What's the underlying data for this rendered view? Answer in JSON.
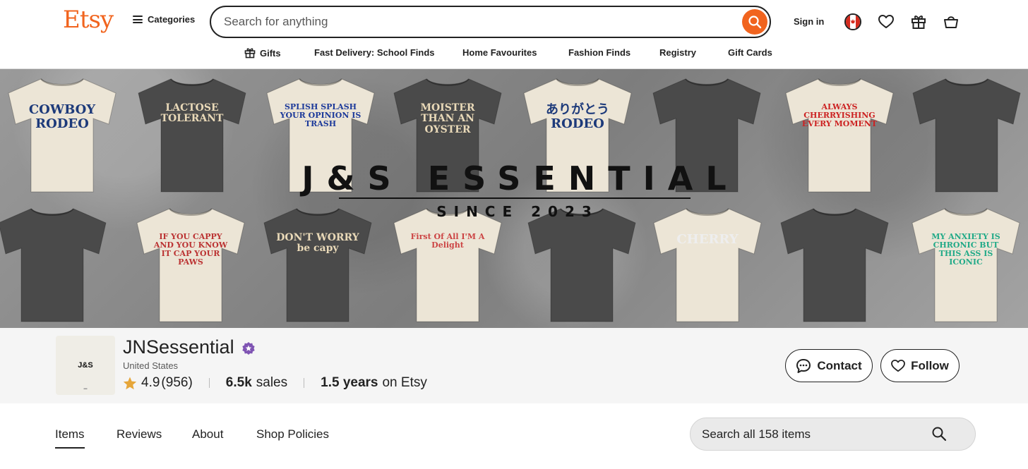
{
  "header": {
    "logo": "Etsy",
    "categories_label": "Categories",
    "search_placeholder": "Search for anything",
    "signin_label": "Sign in"
  },
  "subnav": {
    "items": [
      "Gifts",
      "Fast Delivery: School Finds",
      "Home Favourites",
      "Fashion Finds",
      "Registry",
      "Gift Cards"
    ]
  },
  "banner": {
    "title": "J&S ESSENTIAL",
    "subtitle": "SINCE 2023",
    "shirts_top": [
      "COWBOY RODEO",
      "LACTOSE TOLERANT",
      "SPLISH SPLASH YOUR OPINION IS TRASH",
      "MOISTER THAN AN OYSTER",
      "ありがとう RODEO",
      "",
      "ALWAYS CHERRYISHING EVERY MOMENT",
      ""
    ],
    "shirts_bottom": [
      "",
      "IF YOU CAPPY AND YOU KNOW IT CAP YOUR PAWS",
      "DON'T WORRY be capy",
      "First Of All I'M A Delight",
      "",
      "CHERRY",
      "",
      "MY ANXIETY IS CHRONIC BUT THIS ASS IS ICONIC"
    ]
  },
  "shop": {
    "logo_text": "J&S",
    "name": "JNSessential",
    "location": "United States",
    "rating": "4.9",
    "reviews_count": "(956)",
    "sales_value": "6.5k",
    "sales_label": "sales",
    "years_value": "1.5 years",
    "years_label": "on Etsy",
    "contact_label": "Contact",
    "follow_label": "Follow"
  },
  "tabs": {
    "items": [
      "Items",
      "Reviews",
      "About",
      "Shop Policies"
    ],
    "active": "Items",
    "search_placeholder": "Search all 158 items"
  },
  "colors": {
    "brand": "#F1641E",
    "verified": "#7F54B3",
    "star": "#E6A63A"
  }
}
